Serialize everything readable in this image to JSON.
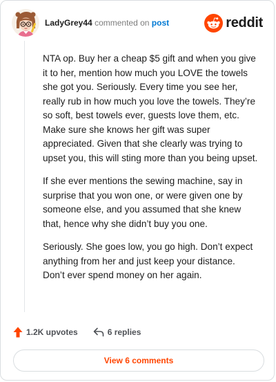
{
  "comment": {
    "author": "LadyGrey44",
    "action_text": "commented on",
    "post_link": "post",
    "paragraphs": [
      "NTA op. Buy her a cheap $5 gift and when you give it to her, mention how much you LOVE the towels she got you. Seriously. Every time you see her, really rub in how much you love the towels. They’re so soft, best towels ever, guests love them, etc. Make sure she knows her gift was super appreciated. Given that she clearly was trying to upset you, this will sting more than you being upset.",
      "If she ever mentions the sewing machine, say in surprise that you won one, or were given one by someone else, and you assumed that she knew that, hence why she didn’t buy you one.",
      "Seriously. She goes low, you go high. Don’t expect anything from her and just keep your distance. Don’t ever spend money on her again."
    ]
  },
  "brand": {
    "name": "reddit",
    "logo_icon": "reddit-snoo-icon"
  },
  "actions": {
    "upvotes_label": "1.2K upvotes",
    "replies_label": "6 replies"
  },
  "footer": {
    "view_comments_label": "View 6 comments"
  },
  "colors": {
    "brand_orange": "#ff4500",
    "link_blue": "#0079d3",
    "text": "#1c1c1c",
    "muted": "#7c7c7c",
    "border": "#d9dde0"
  }
}
